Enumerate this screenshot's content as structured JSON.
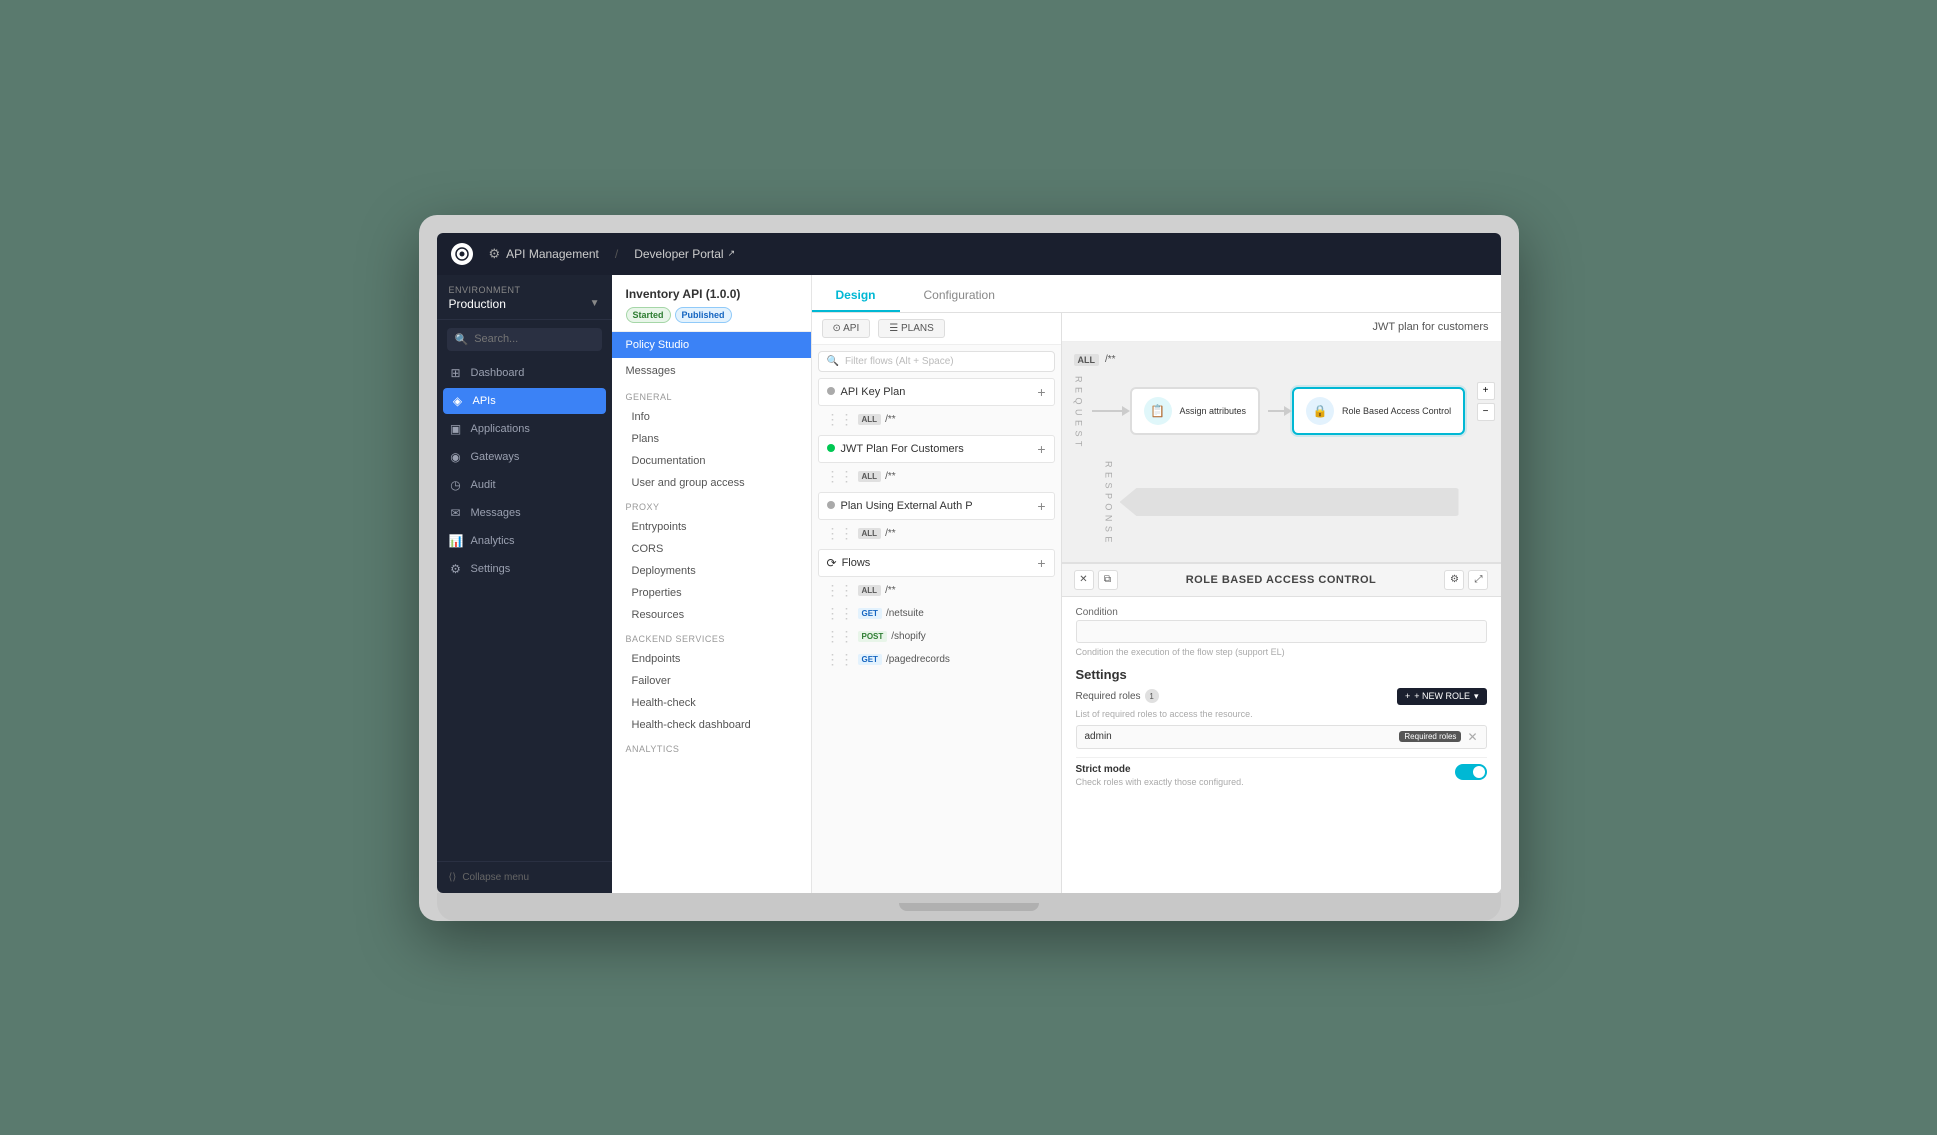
{
  "topbar": {
    "logo": "G",
    "section": "API Management",
    "portal": "Developer Portal",
    "portal_icon": "↗"
  },
  "sidebar": {
    "env_label": "Environment",
    "env_value": "Production",
    "search_placeholder": "Search...",
    "nav_items": [
      {
        "label": "Dashboard",
        "icon": "⊞",
        "active": false
      },
      {
        "label": "APIs",
        "icon": "◈",
        "active": true
      },
      {
        "label": "Applications",
        "icon": "▣",
        "active": false
      },
      {
        "label": "Gateways",
        "icon": "◉",
        "active": false
      },
      {
        "label": "Audit",
        "icon": "◷",
        "active": false
      },
      {
        "label": "Messages",
        "icon": "✉",
        "active": false
      },
      {
        "label": "Analytics",
        "icon": "📊",
        "active": false
      },
      {
        "label": "Settings",
        "icon": "⚙",
        "active": false
      }
    ],
    "collapse_label": "Collapse menu"
  },
  "api_sidebar": {
    "title": "Inventory API (1.0.0)",
    "badges": [
      "Started",
      "Published"
    ],
    "active_menu": "Policy Studio",
    "menu_items": [
      "Messages"
    ],
    "sections": [
      {
        "label": "General",
        "items": [
          "Info",
          "Plans",
          "Documentation",
          "User and group access"
        ]
      },
      {
        "label": "Proxy",
        "items": [
          "Entrypoints",
          "CORS",
          "Deployments",
          "Properties",
          "Resources"
        ]
      },
      {
        "label": "Backend services",
        "items": [
          "Endpoints",
          "Failover",
          "Health-check",
          "Health-check dashboard"
        ]
      },
      {
        "label": "Analytics",
        "items": []
      }
    ]
  },
  "tabs": {
    "design": "Design",
    "configuration": "Configuration"
  },
  "canvas": {
    "btn_api": "API",
    "btn_plans": "PLANS",
    "filter_placeholder": "Filter flows (Alt + Space)",
    "plan_title": "JWT plan for customers",
    "jwt_tag": "JWT plan for customers"
  },
  "plans": [
    {
      "name": "API Key Plan",
      "active": false,
      "flows": [
        {
          "badge": "ALL",
          "path": "/**"
        }
      ]
    },
    {
      "name": "JWT Plan For Customers",
      "active": true,
      "flows": [
        {
          "badge": "ALL",
          "path": "/**"
        }
      ]
    },
    {
      "name": "Plan Using External Auth P",
      "active": false,
      "flows": [
        {
          "badge": "ALL",
          "path": "/**"
        }
      ]
    }
  ],
  "flows_section": {
    "title": "Flows",
    "items": [
      {
        "badge": "ALL",
        "path": "/**"
      },
      {
        "badge": "GET",
        "path": "/netsuite"
      },
      {
        "badge": "POST",
        "path": "/shopify"
      },
      {
        "badge": "GET",
        "path": "/pagedrecords"
      }
    ]
  },
  "diagram": {
    "plan_label": "JWT plan for customers",
    "request_label": "REQUEST",
    "response_label": "RESPONSE",
    "nodes": [
      {
        "label": "Assign attributes",
        "icon": "📋",
        "selected": false
      },
      {
        "label": "Role Based Access Control",
        "icon": "🔒",
        "selected": true
      }
    ]
  },
  "policy_panel": {
    "title": "ROLE BASED ACCESS CONTROL",
    "condition_label": "Condition",
    "condition_sublabel": "Condition the execution of the flow step (support EL)",
    "condition_value": "",
    "settings_title": "Settings",
    "required_roles_label": "Required roles",
    "required_roles_count": "1",
    "required_roles_sublabel": "List of required roles to access the resource.",
    "new_role_btn": "+ NEW ROLE",
    "roles": [
      {
        "value": "admin",
        "badge": "Required roles"
      }
    ],
    "strict_mode_label": "Strict mode",
    "strict_mode_desc": "Check roles with exactly those configured.",
    "strict_mode_enabled": true
  }
}
